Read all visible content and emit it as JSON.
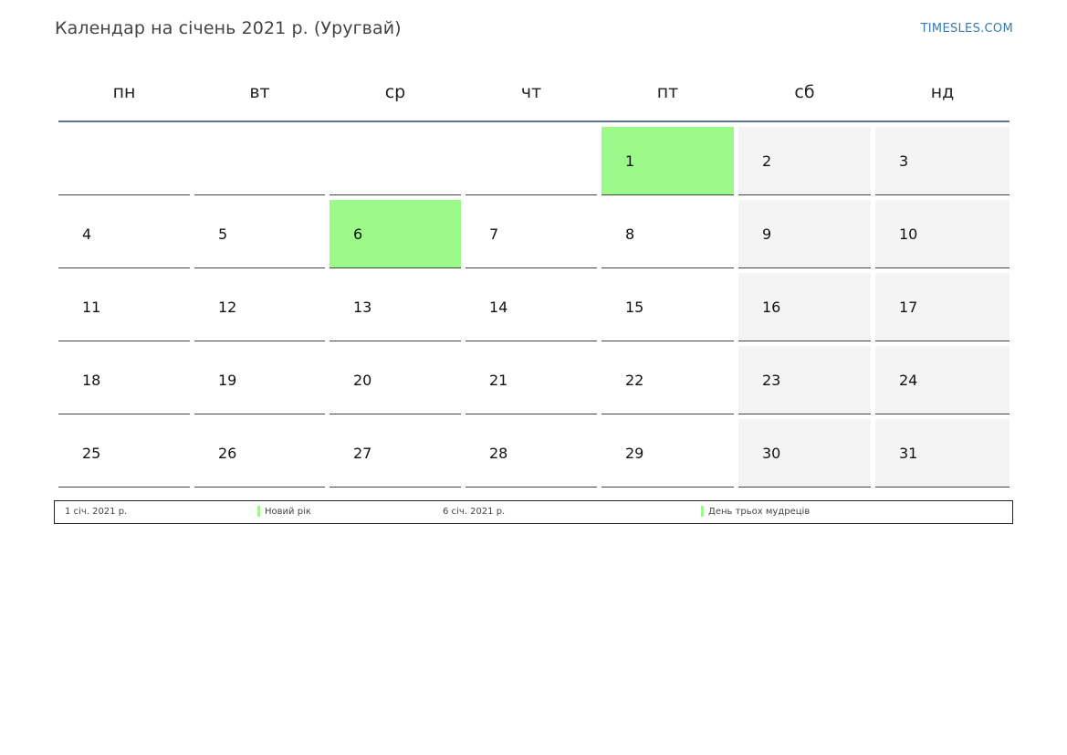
{
  "header": {
    "title": "Календар на січень 2021 р. (Уругвай)",
    "brand": "TIMESLES.COM"
  },
  "weekdays": [
    "пн",
    "вт",
    "ср",
    "чт",
    "пт",
    "сб",
    "нд"
  ],
  "calendar": {
    "leading_blank_days": 4,
    "days": [
      {
        "label": "1",
        "type": "holiday"
      },
      {
        "label": "2",
        "type": "weekend"
      },
      {
        "label": "3",
        "type": "weekend"
      },
      {
        "label": "4",
        "type": "normal"
      },
      {
        "label": "5",
        "type": "normal"
      },
      {
        "label": "6",
        "type": "holiday"
      },
      {
        "label": "7",
        "type": "normal"
      },
      {
        "label": "8",
        "type": "normal"
      },
      {
        "label": "9",
        "type": "weekend"
      },
      {
        "label": "10",
        "type": "weekend"
      },
      {
        "label": "11",
        "type": "normal"
      },
      {
        "label": "12",
        "type": "normal"
      },
      {
        "label": "13",
        "type": "normal"
      },
      {
        "label": "14",
        "type": "normal"
      },
      {
        "label": "15",
        "type": "normal"
      },
      {
        "label": "16",
        "type": "weekend"
      },
      {
        "label": "17",
        "type": "weekend"
      },
      {
        "label": "18",
        "type": "normal"
      },
      {
        "label": "19",
        "type": "normal"
      },
      {
        "label": "20",
        "type": "normal"
      },
      {
        "label": "21",
        "type": "normal"
      },
      {
        "label": "22",
        "type": "normal"
      },
      {
        "label": "23",
        "type": "weekend"
      },
      {
        "label": "24",
        "type": "weekend"
      },
      {
        "label": "25",
        "type": "normal"
      },
      {
        "label": "26",
        "type": "normal"
      },
      {
        "label": "27",
        "type": "normal"
      },
      {
        "label": "28",
        "type": "normal"
      },
      {
        "label": "29",
        "type": "normal"
      },
      {
        "label": "30",
        "type": "weekend"
      },
      {
        "label": "31",
        "type": "weekend"
      }
    ]
  },
  "legend": {
    "items": [
      {
        "date": "1 січ. 2021 р.",
        "name": "Новий рік"
      },
      {
        "date": "6 січ. 2021 р.",
        "name": "День трьох мудреців"
      }
    ]
  },
  "colors": {
    "holiday": "#9bfa8a",
    "weekend": "#f4f4f4",
    "header_rule": "#5d7491",
    "brand": "#3a7ab5"
  }
}
